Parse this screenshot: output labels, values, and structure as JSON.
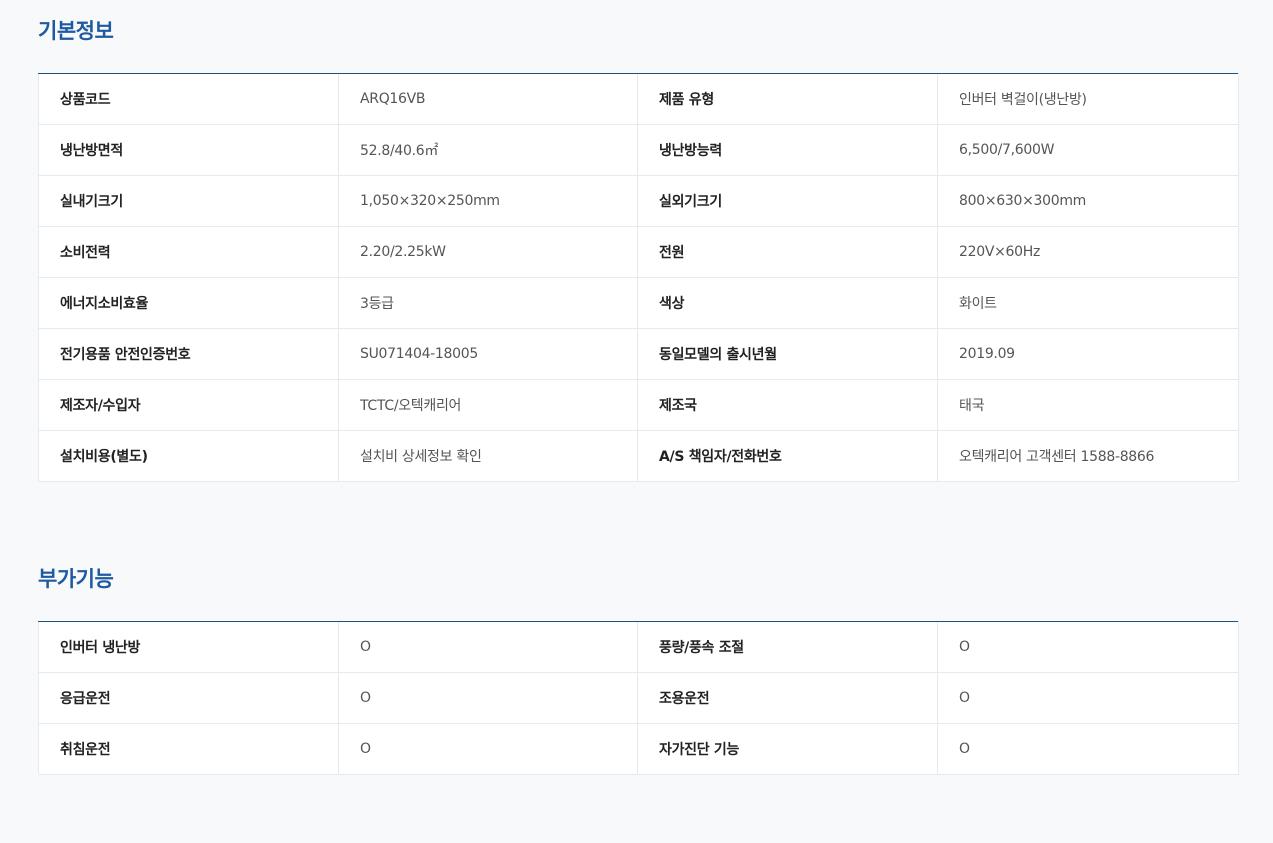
{
  "basic_info": {
    "title": "기본정보",
    "rows": [
      {
        "label1": "상품코드",
        "value1": "ARQ16VB",
        "label2": "제품 유형",
        "value2": "인버터 벽걸이(냉난방)"
      },
      {
        "label1": "냉난방면적",
        "value1": "52.8/40.6㎡",
        "label2": "냉난방능력",
        "value2": "6,500/7,600W"
      },
      {
        "label1": "실내기크기",
        "value1": "1,050×320×250mm",
        "label2": "실외기크기",
        "value2": "800×630×300mm"
      },
      {
        "label1": "소비전력",
        "value1": "2.20/2.25kW",
        "label2": "전원",
        "value2": "220V×60Hz"
      },
      {
        "label1": "에너지소비효율",
        "value1": "3등급",
        "label2": "색상",
        "value2": "화이트"
      },
      {
        "label1": "전기용품 안전인증번호",
        "value1": "SU071404-18005",
        "label2": "동일모델의 출시년월",
        "value2": "2019.09"
      },
      {
        "label1": "제조자/수입자",
        "value1": "TCTC/오텍캐리어",
        "label2": "제조국",
        "value2": "태국"
      },
      {
        "label1": "설치비용(별도)",
        "value1": "설치비 상세정보 확인",
        "label2": "A/S 책임자/전화번호",
        "value2": "오텍캐리어 고객센터 1588-8866"
      }
    ]
  },
  "extra_features": {
    "title": "부가기능",
    "rows": [
      {
        "label1": "인버터 냉난방",
        "value1": "O",
        "label2": "풍량/풍속 조절",
        "value2": "O"
      },
      {
        "label1": "응급운전",
        "value1": "O",
        "label2": "조용운전",
        "value2": "O"
      },
      {
        "label1": "취침운전",
        "value1": "O",
        "label2": "자가진단 기능",
        "value2": "O"
      }
    ]
  },
  "colors": {
    "accent": "#1f5aa0",
    "background": "#f7f9fb",
    "table_top_border": "#1f4f7f",
    "cell_border": "#e6e9ed"
  }
}
